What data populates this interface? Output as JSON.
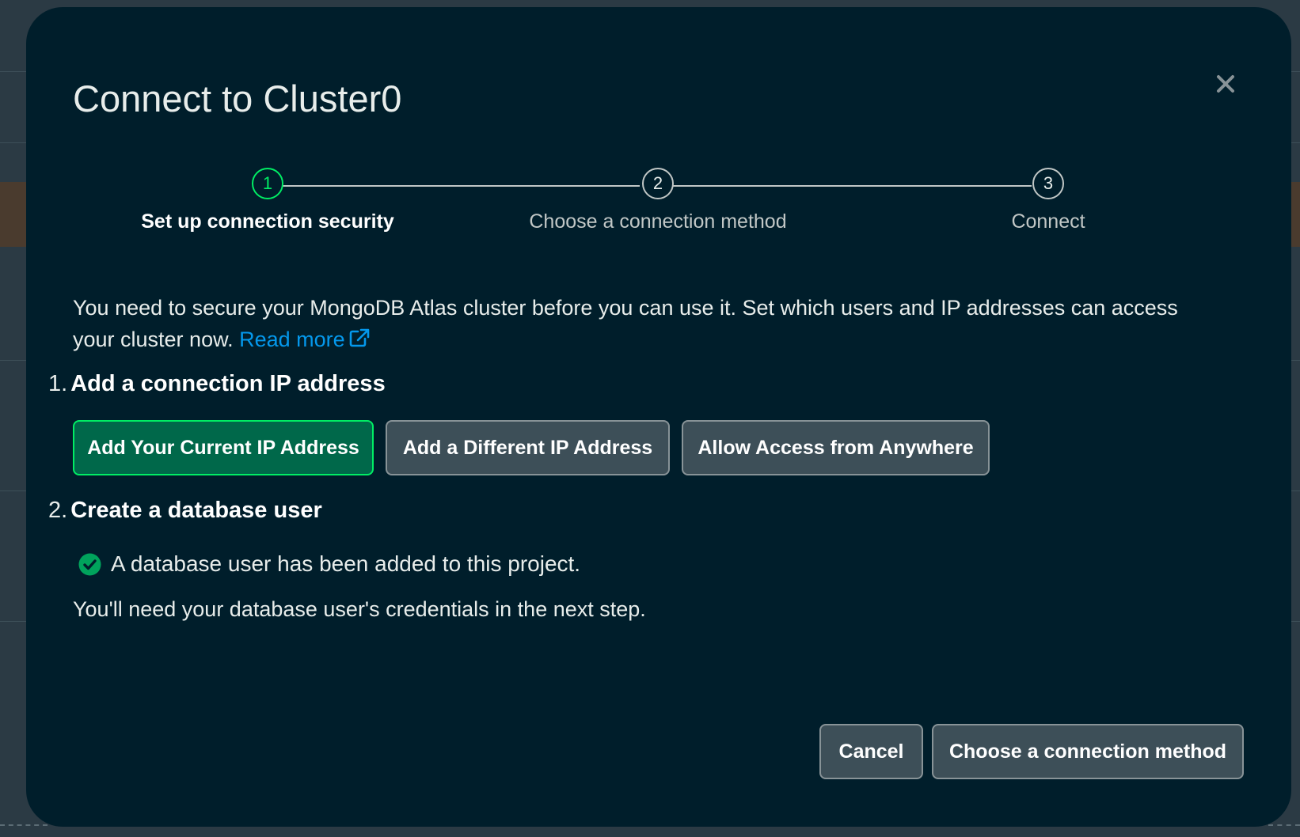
{
  "modal": {
    "title": "Connect to Cluster0",
    "close_icon": "close-icon"
  },
  "stepper": {
    "steps": [
      {
        "number": "1",
        "label": "Set up connection security",
        "active": true
      },
      {
        "number": "2",
        "label": "Choose a connection method",
        "active": false
      },
      {
        "number": "3",
        "label": "Connect",
        "active": false
      }
    ]
  },
  "intro": {
    "text": "You need to secure your MongoDB Atlas cluster before you can use it. Set which users and IP addresses can access your cluster now.",
    "link_label": "Read more",
    "link_icon": "external-link-icon"
  },
  "section_ip": {
    "number": "1.",
    "heading": "Add a connection IP address",
    "buttons": [
      {
        "label": "Add Your Current IP Address"
      },
      {
        "label": "Add a Different IP Address"
      },
      {
        "label": "Allow Access from Anywhere"
      }
    ]
  },
  "section_user": {
    "number": "2.",
    "heading": "Create a database user",
    "status_icon": "check-circle-icon",
    "status_text": "A database user has been added to this project.",
    "note": "You'll need your database user's credentials in the next step."
  },
  "footer": {
    "cancel_label": "Cancel",
    "next_label": "Choose a connection method"
  },
  "colors": {
    "modal_bg": "#001e2b",
    "accent_green": "#00ed64",
    "primary_button_bg": "#00684a",
    "link_blue": "#0498ec",
    "secondary_button_bg": "#3d4f58"
  }
}
